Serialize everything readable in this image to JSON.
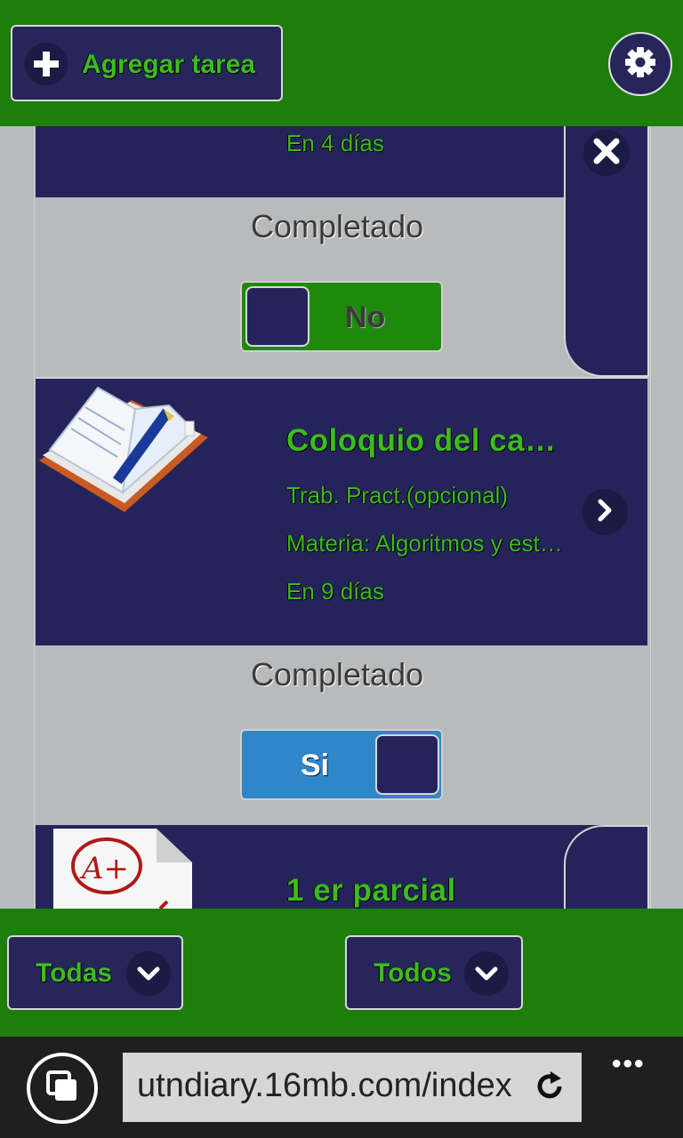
{
  "header": {
    "add_task_label": "Agregar tarea",
    "add_icon": "plus-icon",
    "settings_icon": "gear-icon"
  },
  "tasks": [
    {
      "due": "En 4 días",
      "completed_label": "Completado",
      "toggle_label": "No",
      "completed": false,
      "action_icon": "close-icon"
    },
    {
      "title": "Coloquio del ca…",
      "type": "Trab. Pract.(opcional)",
      "subject": "Materia: Algoritmos y est…",
      "due": "En 9 días",
      "completed_label": "Completado",
      "toggle_label": "Si",
      "completed": true,
      "thumbnail_icon": "open-book-icon",
      "action_icon": "chevron-right-icon"
    },
    {
      "title": "1 er parcial",
      "thumbnail_icon": "graded-paper-icon"
    }
  ],
  "footer": {
    "filter1_label": "Todas",
    "filter2_label": "Todos"
  },
  "browser": {
    "url": "utndiary.16mb.com/index",
    "more": "•••"
  },
  "colors": {
    "header_green": "#1e7e0c",
    "panel_navy": "#25245a",
    "text_green": "#3dbb1f",
    "toggle_on_blue": "#2f86c8"
  }
}
